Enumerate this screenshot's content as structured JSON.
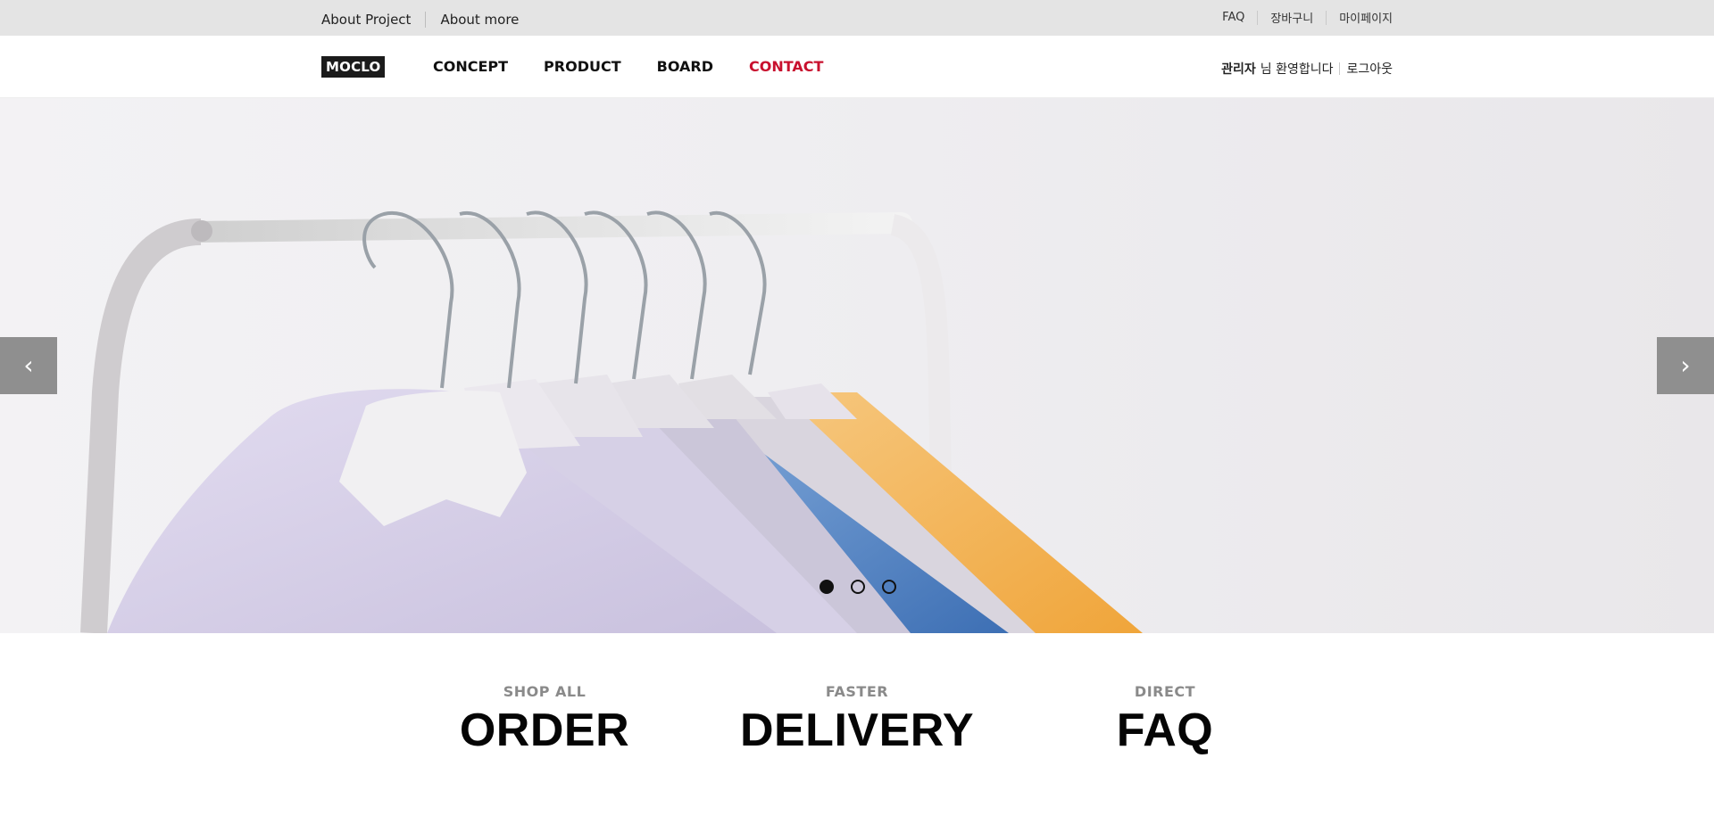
{
  "topbar": {
    "left_links": [
      "About Project",
      "About more"
    ],
    "right_links": [
      "FAQ",
      "장바구니",
      "마이페이지"
    ]
  },
  "header": {
    "logo": "MOCLO",
    "nav": [
      "CONCEPT",
      "PRODUCT",
      "BOARD",
      "CONTACT"
    ],
    "active_nav": "CONTACT",
    "user_name": "관리자",
    "welcome": "님 환영합니다",
    "logout": "로그아웃"
  },
  "hero": {
    "prev_icon": "chevron-left-icon",
    "next_icon": "chevron-right-icon",
    "prev_glyph": "‹",
    "next_glyph": "›",
    "slides": 3,
    "active_slide": 1
  },
  "features": [
    {
      "small": "SHOP ALL",
      "big": "ORDER"
    },
    {
      "small": "FASTER",
      "big": "DELIVERY"
    },
    {
      "small": "DIRECT",
      "big": "FAQ"
    }
  ],
  "colors": {
    "accent": "#c8102e",
    "topbar_bg": "#e4e4e4",
    "arrow_bg": "#8f8f8f",
    "logo_bg": "#1b1b1b"
  }
}
